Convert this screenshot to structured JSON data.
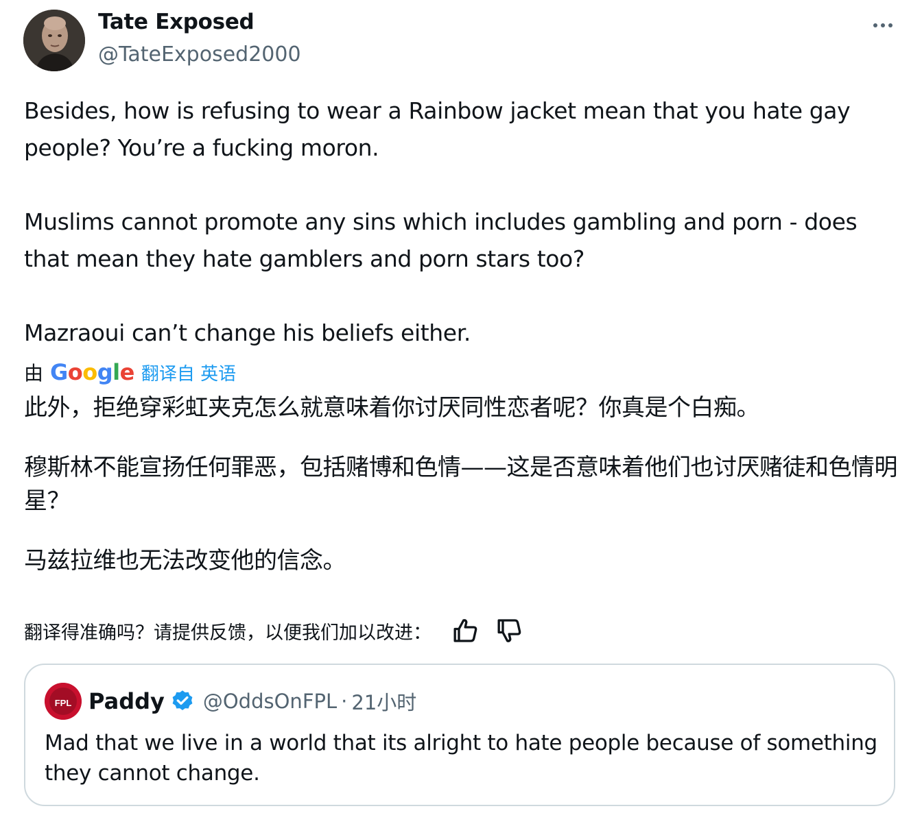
{
  "author": {
    "display_name": "Tate Exposed",
    "handle": "@TateExposed2000",
    "avatar_icon": "person-avatar-icon"
  },
  "more_menu_icon": "more-horizontal-icon",
  "tweet": {
    "paragraphs": [
      "Besides, how is refusing to wear a Rainbow jacket mean that you hate gay people? You’re a fucking moron.",
      "Muslims cannot promote any sins which includes gambling and porn - does that mean they hate gamblers and porn stars too?",
      "Mazraoui can’t change his beliefs either."
    ]
  },
  "translation": {
    "by_label": "由",
    "provider": "Google",
    "from_label": "翻译自 英语",
    "paragraphs": [
      "此外，拒绝穿彩虹夹克怎么就意味着你讨厌同性恋者呢？你真是个白痴。",
      "穆斯林不能宣扬任何罪恶，包括赌博和色情——这是否意味着他们也讨厌赌徒和色情明星？",
      "马兹拉维也无法改变他的信念。"
    ],
    "feedback_prompt": "翻译得准确吗？请提供反馈，以便我们加以改进：",
    "thumbs_up_icon": "thumbs-up-icon",
    "thumbs_down_icon": "thumbs-down-icon"
  },
  "quote": {
    "display_name": "Paddy",
    "verified_icon": "verified-badge-icon",
    "avatar_text": "FPL",
    "handle": "@OddsOnFPL",
    "separator": "·",
    "time": "21小时",
    "text": "Mad that we live in a world that its alright to hate people because of something they cannot change."
  },
  "colors": {
    "text": "#0f1419",
    "secondary": "#536471",
    "accent": "#1d9bf0",
    "border": "#cfd9de",
    "google_blue": "#4285f4",
    "google_red": "#ea4335",
    "google_yellow": "#fbbc05",
    "google_green": "#34a853"
  }
}
